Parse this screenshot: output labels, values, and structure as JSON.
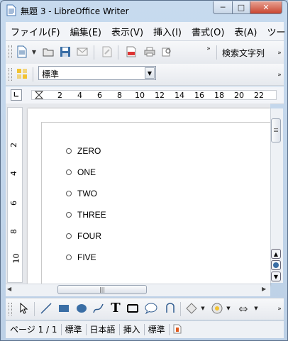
{
  "window": {
    "title": "無題 3 - LibreOffice Writer",
    "minimize_label": "─",
    "maximize_label": "□",
    "close_label": "✕"
  },
  "menubar": {
    "items": [
      "ファイル(F)",
      "編集(E)",
      "表示(V)",
      "挿入(I)",
      "書式(O)",
      "表(A)",
      "ツー"
    ]
  },
  "standard_toolbar": {
    "search_label": "検索文字列"
  },
  "formatting_toolbar": {
    "paragraph_style": "標準"
  },
  "ruler": {
    "numbers": [
      "2",
      "4",
      "6",
      "8",
      "10",
      "12",
      "14",
      "16",
      "18",
      "20",
      "22"
    ],
    "vertical_numbers": [
      "2",
      "4",
      "6",
      "8",
      "10"
    ]
  },
  "document": {
    "list_items": [
      "ZERO",
      "ONE",
      "TWO",
      "THREE",
      "FOUR",
      "FIVE"
    ]
  },
  "statusbar": {
    "page": "ページ 1 / 1",
    "style": "標準",
    "language": "日本語",
    "insert_mode": "挿入",
    "selection_mode": "標準"
  },
  "colors": {
    "window_frame": "#b9d1ea",
    "close_button": "#c9452f",
    "page_background": "#ffffff"
  }
}
